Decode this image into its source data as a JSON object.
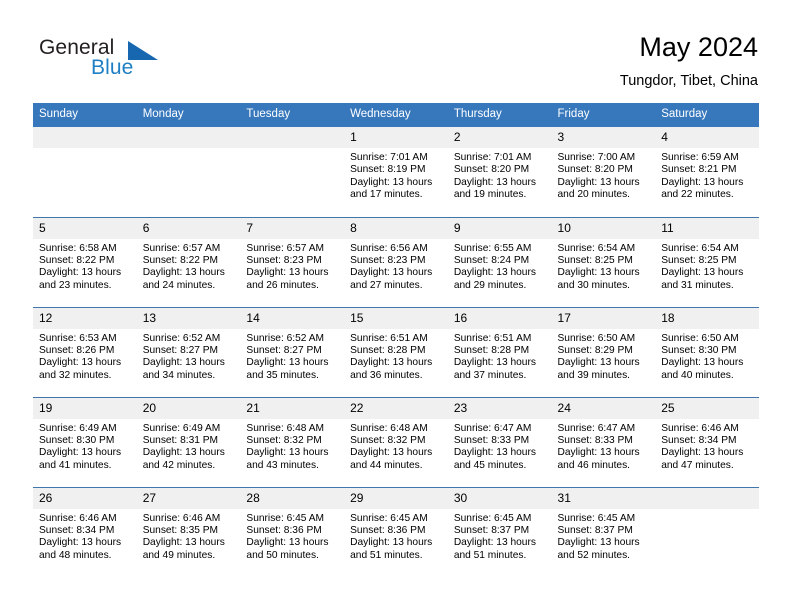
{
  "brand": {
    "name_primary": "General",
    "name_secondary": "Blue",
    "accent_color": "#1667b0",
    "text_color": "#231f20"
  },
  "header": {
    "title": "May 2024",
    "subtitle": "Tungdor, Tibet, China"
  },
  "theme": {
    "header_bg": "#3778bd",
    "header_text": "#ffffff",
    "daynum_bg": "#f0f0f0",
    "week_separator": "#4076ab"
  },
  "weekdays": [
    "Sunday",
    "Monday",
    "Tuesday",
    "Wednesday",
    "Thursday",
    "Friday",
    "Saturday"
  ],
  "labels": {
    "sunrise_prefix": "Sunrise:",
    "sunset_prefix": "Sunset:",
    "daylight_prefix": "Daylight:"
  },
  "weeks": [
    [
      {
        "day": "",
        "empty": true
      },
      {
        "day": "",
        "empty": true
      },
      {
        "day": "",
        "empty": true
      },
      {
        "day": "1",
        "sunrise": "Sunrise: 7:01 AM",
        "sunset": "Sunset: 8:19 PM",
        "daylight": "Daylight: 13 hours and 17 minutes."
      },
      {
        "day": "2",
        "sunrise": "Sunrise: 7:01 AM",
        "sunset": "Sunset: 8:20 PM",
        "daylight": "Daylight: 13 hours and 19 minutes."
      },
      {
        "day": "3",
        "sunrise": "Sunrise: 7:00 AM",
        "sunset": "Sunset: 8:20 PM",
        "daylight": "Daylight: 13 hours and 20 minutes."
      },
      {
        "day": "4",
        "sunrise": "Sunrise: 6:59 AM",
        "sunset": "Sunset: 8:21 PM",
        "daylight": "Daylight: 13 hours and 22 minutes."
      }
    ],
    [
      {
        "day": "5",
        "sunrise": "Sunrise: 6:58 AM",
        "sunset": "Sunset: 8:22 PM",
        "daylight": "Daylight: 13 hours and 23 minutes."
      },
      {
        "day": "6",
        "sunrise": "Sunrise: 6:57 AM",
        "sunset": "Sunset: 8:22 PM",
        "daylight": "Daylight: 13 hours and 24 minutes."
      },
      {
        "day": "7",
        "sunrise": "Sunrise: 6:57 AM",
        "sunset": "Sunset: 8:23 PM",
        "daylight": "Daylight: 13 hours and 26 minutes."
      },
      {
        "day": "8",
        "sunrise": "Sunrise: 6:56 AM",
        "sunset": "Sunset: 8:23 PM",
        "daylight": "Daylight: 13 hours and 27 minutes."
      },
      {
        "day": "9",
        "sunrise": "Sunrise: 6:55 AM",
        "sunset": "Sunset: 8:24 PM",
        "daylight": "Daylight: 13 hours and 29 minutes."
      },
      {
        "day": "10",
        "sunrise": "Sunrise: 6:54 AM",
        "sunset": "Sunset: 8:25 PM",
        "daylight": "Daylight: 13 hours and 30 minutes."
      },
      {
        "day": "11",
        "sunrise": "Sunrise: 6:54 AM",
        "sunset": "Sunset: 8:25 PM",
        "daylight": "Daylight: 13 hours and 31 minutes."
      }
    ],
    [
      {
        "day": "12",
        "sunrise": "Sunrise: 6:53 AM",
        "sunset": "Sunset: 8:26 PM",
        "daylight": "Daylight: 13 hours and 32 minutes."
      },
      {
        "day": "13",
        "sunrise": "Sunrise: 6:52 AM",
        "sunset": "Sunset: 8:27 PM",
        "daylight": "Daylight: 13 hours and 34 minutes."
      },
      {
        "day": "14",
        "sunrise": "Sunrise: 6:52 AM",
        "sunset": "Sunset: 8:27 PM",
        "daylight": "Daylight: 13 hours and 35 minutes."
      },
      {
        "day": "15",
        "sunrise": "Sunrise: 6:51 AM",
        "sunset": "Sunset: 8:28 PM",
        "daylight": "Daylight: 13 hours and 36 minutes."
      },
      {
        "day": "16",
        "sunrise": "Sunrise: 6:51 AM",
        "sunset": "Sunset: 8:28 PM",
        "daylight": "Daylight: 13 hours and 37 minutes."
      },
      {
        "day": "17",
        "sunrise": "Sunrise: 6:50 AM",
        "sunset": "Sunset: 8:29 PM",
        "daylight": "Daylight: 13 hours and 39 minutes."
      },
      {
        "day": "18",
        "sunrise": "Sunrise: 6:50 AM",
        "sunset": "Sunset: 8:30 PM",
        "daylight": "Daylight: 13 hours and 40 minutes."
      }
    ],
    [
      {
        "day": "19",
        "sunrise": "Sunrise: 6:49 AM",
        "sunset": "Sunset: 8:30 PM",
        "daylight": "Daylight: 13 hours and 41 minutes."
      },
      {
        "day": "20",
        "sunrise": "Sunrise: 6:49 AM",
        "sunset": "Sunset: 8:31 PM",
        "daylight": "Daylight: 13 hours and 42 minutes."
      },
      {
        "day": "21",
        "sunrise": "Sunrise: 6:48 AM",
        "sunset": "Sunset: 8:32 PM",
        "daylight": "Daylight: 13 hours and 43 minutes."
      },
      {
        "day": "22",
        "sunrise": "Sunrise: 6:48 AM",
        "sunset": "Sunset: 8:32 PM",
        "daylight": "Daylight: 13 hours and 44 minutes."
      },
      {
        "day": "23",
        "sunrise": "Sunrise: 6:47 AM",
        "sunset": "Sunset: 8:33 PM",
        "daylight": "Daylight: 13 hours and 45 minutes."
      },
      {
        "day": "24",
        "sunrise": "Sunrise: 6:47 AM",
        "sunset": "Sunset: 8:33 PM",
        "daylight": "Daylight: 13 hours and 46 minutes."
      },
      {
        "day": "25",
        "sunrise": "Sunrise: 6:46 AM",
        "sunset": "Sunset: 8:34 PM",
        "daylight": "Daylight: 13 hours and 47 minutes."
      }
    ],
    [
      {
        "day": "26",
        "sunrise": "Sunrise: 6:46 AM",
        "sunset": "Sunset: 8:34 PM",
        "daylight": "Daylight: 13 hours and 48 minutes."
      },
      {
        "day": "27",
        "sunrise": "Sunrise: 6:46 AM",
        "sunset": "Sunset: 8:35 PM",
        "daylight": "Daylight: 13 hours and 49 minutes."
      },
      {
        "day": "28",
        "sunrise": "Sunrise: 6:45 AM",
        "sunset": "Sunset: 8:36 PM",
        "daylight": "Daylight: 13 hours and 50 minutes."
      },
      {
        "day": "29",
        "sunrise": "Sunrise: 6:45 AM",
        "sunset": "Sunset: 8:36 PM",
        "daylight": "Daylight: 13 hours and 51 minutes."
      },
      {
        "day": "30",
        "sunrise": "Sunrise: 6:45 AM",
        "sunset": "Sunset: 8:37 PM",
        "daylight": "Daylight: 13 hours and 51 minutes."
      },
      {
        "day": "31",
        "sunrise": "Sunrise: 6:45 AM",
        "sunset": "Sunset: 8:37 PM",
        "daylight": "Daylight: 13 hours and 52 minutes."
      },
      {
        "day": "",
        "empty": true
      }
    ]
  ]
}
